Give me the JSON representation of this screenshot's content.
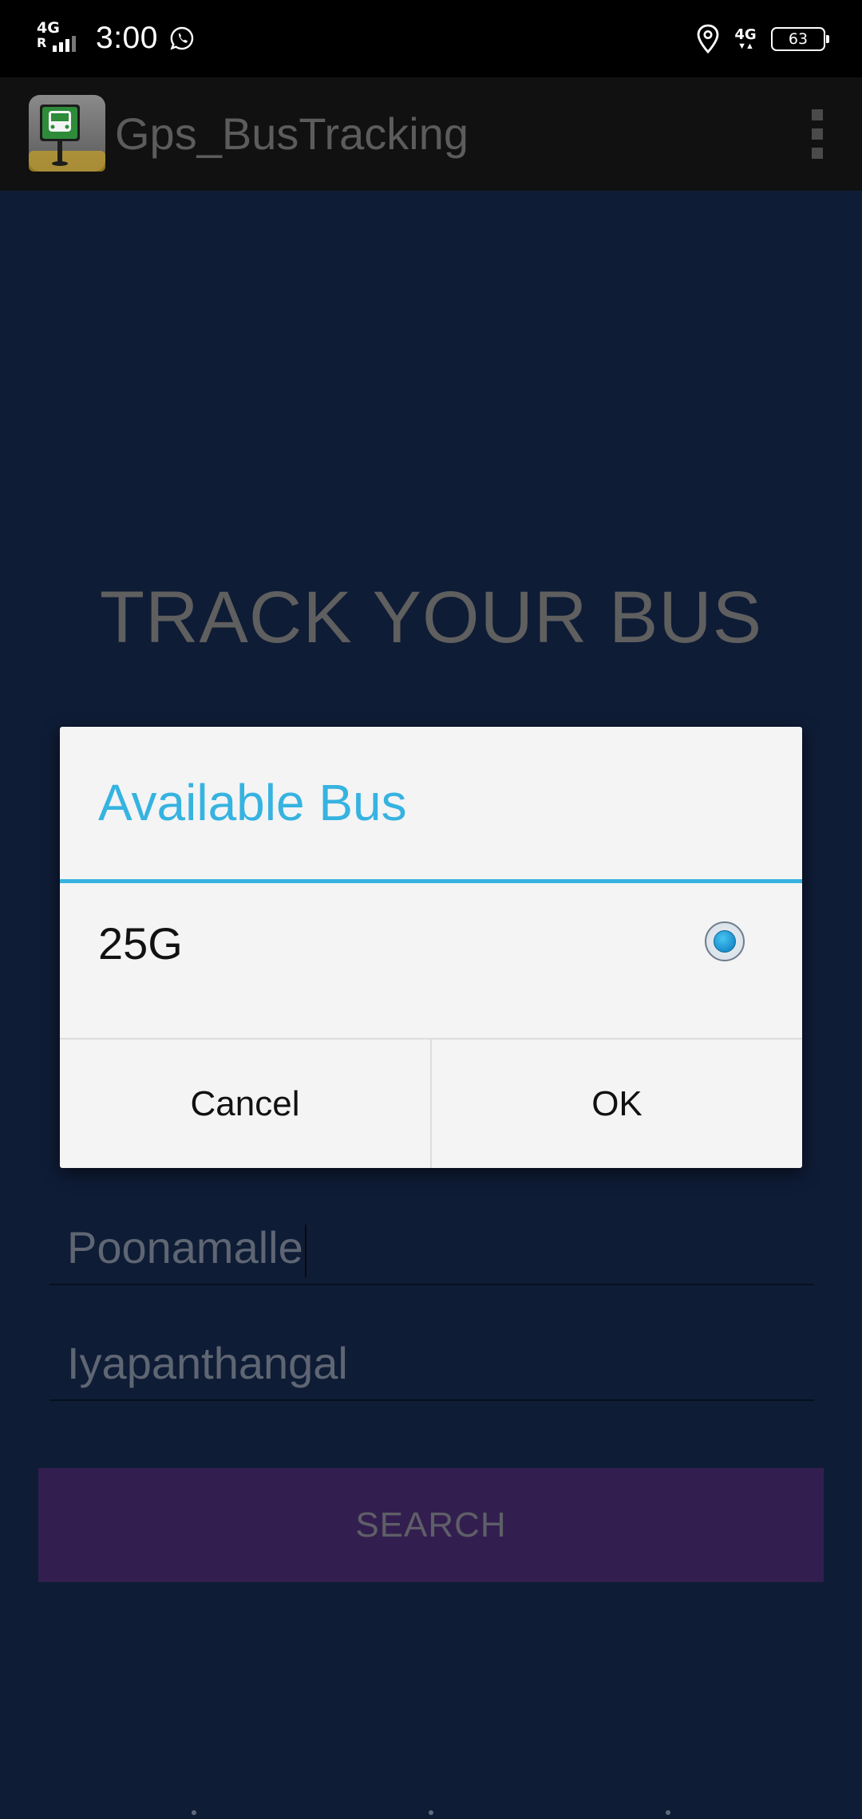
{
  "status_bar": {
    "network_left": "4G",
    "network_left_sub": "R",
    "time": "3:00",
    "network_right": "4G",
    "battery": "63"
  },
  "app_bar": {
    "title": "Gps_BusTracking",
    "icon": "bus-stop-icon",
    "menu_icon": "overflow-menu-icon"
  },
  "main": {
    "heading": "TRACK YOUR BUS",
    "from_value": "Poonamalle",
    "to_value": "Iyapanthangal",
    "search_label": "SEARCH"
  },
  "dialog": {
    "title": "Available Bus",
    "options": [
      {
        "label": "25G",
        "selected": true
      }
    ],
    "cancel_label": "Cancel",
    "ok_label": "OK"
  },
  "colors": {
    "background": "#0f1c36",
    "accent": "#36b3e0",
    "search_button": "#331f4f",
    "app_bar": "#111111"
  }
}
